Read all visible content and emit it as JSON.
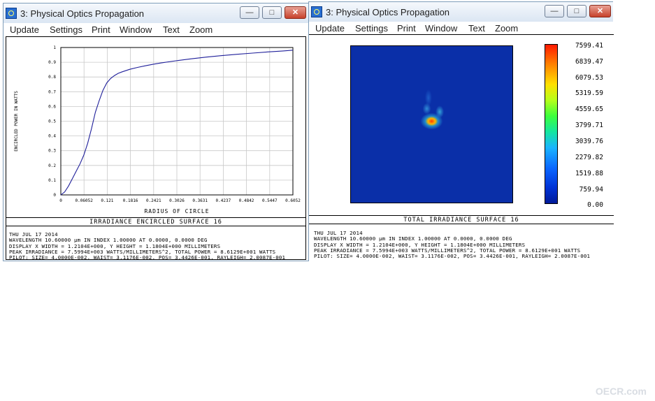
{
  "colors": {
    "curve": "#1f1f9a",
    "grid": "#c8c8c8",
    "field_bg": "#0a2fa8"
  },
  "left_window": {
    "title": "3: Physical Optics Propagation",
    "menu": [
      "Update",
      "Settings",
      "Print",
      "Window",
      "Text",
      "Zoom"
    ],
    "caption": "IRRADIANCE ENCIRCLED SURFACE 16",
    "info_lines": [
      "THU JUL 17 2014",
      "WAVELENGTH 10.60000 µm IN INDEX 1.00000 AT 0.0000, 0.0000 DEG",
      "DISPLAY X WIDTH = 1.2104E+000, Y HEIGHT = 1.1804E+000 MILLIMETERS",
      "PEAK IRRADIANCE = 7.5994E+003 WATTS/MILLIMETERS^2, TOTAL POWER = 8.6129E+001 WATTS",
      "PILOT: SIZE= 4.0000E-002, WAIST= 3.1176E-002, POS= 3.4426E-001, RAYLEIGH= 2.0087E-001"
    ]
  },
  "right_window": {
    "title": "3: Physical Optics Propagation",
    "menu": [
      "Update",
      "Settings",
      "Print",
      "Window",
      "Text",
      "Zoom"
    ],
    "caption": "TOTAL IRRADIANCE SURFACE 16",
    "info_lines": [
      "THU JUL 17 2014",
      "WAVELENGTH 10.60000 µm IN INDEX 1.00000 AT 0.0000, 0.0000 DEG",
      "DISPLAY X WIDTH = 1.2104E+000, Y HEIGHT = 1.1804E+000 MILLIMETERS",
      "PEAK IRRADIANCE = 7.5994E+003 WATTS/MILLIMETERS^2, TOTAL POWER = 8.6129E+001 WATTS",
      "PILOT: SIZE= 4.0000E-002, WAIST= 3.1176E-002, POS= 3.4426E-001, RAYLEIGH= 2.0087E-001"
    ],
    "colorbar_labels": [
      "7599.41",
      "6839.47",
      "6079.53",
      "5319.59",
      "4559.65",
      "3799.71",
      "3039.76",
      "2279.82",
      "1519.88",
      "759.94",
      "0.00"
    ]
  },
  "watermark": "OECR.com",
  "chart_data": {
    "type": "line",
    "xlabel": "RADIUS OF CIRCLE",
    "ylabel": "ENCIRCLED POWER IN WATTS",
    "x_ticks": [
      "0",
      "0.06052",
      "0.121",
      "0.1816",
      "0.2421",
      "0.3026",
      "0.3631",
      "0.4237",
      "0.4842",
      "0.5447",
      "0.6052"
    ],
    "y_ticks": [
      "0",
      "0.1",
      "0.2",
      "0.3",
      "0.4",
      "0.5",
      "0.6",
      "0.7",
      "0.8",
      "0.9",
      "1"
    ],
    "xlim": [
      0,
      0.6052
    ],
    "ylim": [
      0,
      1
    ],
    "grid": true,
    "series": [
      {
        "x": [
          0,
          0.01,
          0.02,
          0.03,
          0.04,
          0.05,
          0.06,
          0.07,
          0.08,
          0.09,
          0.1,
          0.11,
          0.12,
          0.13,
          0.14,
          0.15,
          0.16,
          0.18,
          0.2,
          0.22,
          0.24,
          0.26,
          0.3,
          0.34,
          0.38,
          0.42,
          0.46,
          0.5,
          0.54,
          0.58,
          0.6052
        ],
        "y": [
          0,
          0.02,
          0.06,
          0.11,
          0.16,
          0.21,
          0.27,
          0.35,
          0.45,
          0.56,
          0.64,
          0.71,
          0.76,
          0.79,
          0.81,
          0.825,
          0.835,
          0.852,
          0.865,
          0.876,
          0.886,
          0.895,
          0.91,
          0.923,
          0.935,
          0.945,
          0.954,
          0.962,
          0.97,
          0.977,
          0.982
        ]
      }
    ]
  }
}
